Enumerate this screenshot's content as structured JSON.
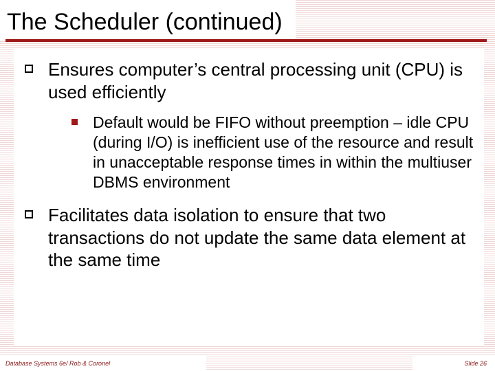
{
  "title": "The Scheduler (continued)",
  "bullets": {
    "b1": "Ensures computer’s central processing unit (CPU) is used efficiently",
    "b1_sub1": "Default would be FIFO without preemption – idle CPU (during I/O) is inefficient use of the resource and result in unacceptable response times in within the multiuser DBMS environment",
    "b2": "Facilitates data isolation to ensure that two transactions do not update the same data element at the same time"
  },
  "footer": {
    "left": "Database Systems 6e/ Rob & Coronel",
    "right": "Slide 26"
  }
}
